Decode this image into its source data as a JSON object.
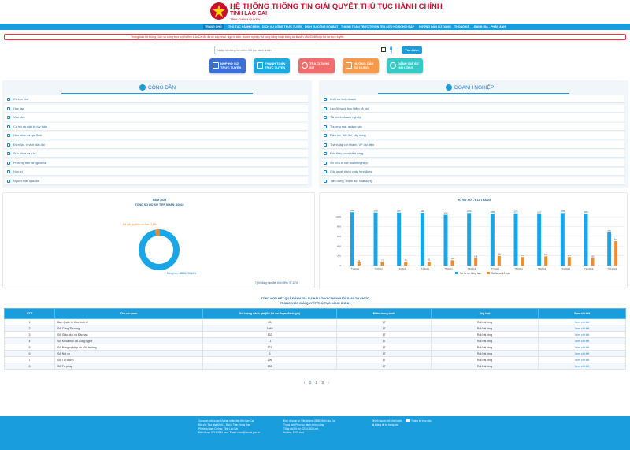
{
  "header": {
    "title_line1": "HỆ THỐNG THÔNG TIN GIẢI QUYẾT THỦ TỤC HÀNH CHÍNH",
    "title_line2": "TỈNH LÀO CAI",
    "subtitle": "TỈNH CHÍNH QUYỀN",
    "brand_color": "#c8102e"
  },
  "nav": {
    "items": [
      {
        "label": "TRANG CHỦ"
      },
      {
        "label": "THỦ TỤC HÀNH CHÍNH"
      },
      {
        "label": "DỊCH VỤ CÔNG TRỰC TUYẾN"
      },
      {
        "label": "DỊCH VỤ CÔNG NỔI BẬT"
      },
      {
        "label": "THANH TOÁN TRỰC TUYẾN"
      },
      {
        "label": "TRA CỨU HỒ SƠ"
      },
      {
        "label": "HỎI ĐÁP"
      },
      {
        "label": "HƯỚNG DẪN SỬ DỤNG"
      },
      {
        "label": "THỐNG KÊ"
      },
      {
        "label": "ĐÁNH GIÁ - PHẢN ÁNH"
      }
    ],
    "color": "#1a9ddc"
  },
  "marquee": {
    "text": "Thông báo hệ thống Dịch vụ công trực tuyến tỉnh Lào Cai đã được cập nhật. Người dân, doanh nghiệp vui lòng đăng nhập bằng tài khoản VNeID để nộp hồ sơ trực tuyến."
  },
  "search": {
    "placeholder": "Nhập nội dung tìm kiếm thủ tục hành chính",
    "button": "Tìm kiếm"
  },
  "quick_actions": [
    {
      "label": "NỘP HỒ SƠ TRỰC TUYẾN",
      "color": "#3a6fd8"
    },
    {
      "label": "THANH TOÁN TRỰC TUYẾN",
      "color": "#1aa9e0"
    },
    {
      "label": "TRA CỨU HỒ SƠ",
      "color": "#f16d6d"
    },
    {
      "label": "HƯỚNG DẪN SỬ DỤNG",
      "color": "#f59a4a"
    },
    {
      "label": "ĐÁNH GIÁ SỰ HÀI LÒNG",
      "color": "#36c9c6"
    }
  ],
  "citizen": {
    "title": "CÔNG DÂN",
    "items": [
      {
        "label": "Có con nhỏ"
      },
      {
        "label": "Học tập"
      },
      {
        "label": "Việc làm"
      },
      {
        "label": "Cư trú và giấy tờ tùy thân"
      },
      {
        "label": "Hôn nhân và gia đình"
      },
      {
        "label": "Điện lực, nhà ở, đất đai"
      },
      {
        "label": "Sức khỏe và y tế"
      },
      {
        "label": "Phương tiện và người lái"
      },
      {
        "label": "Hưu trí"
      },
      {
        "label": "Người thân qua đời"
      }
    ]
  },
  "business": {
    "title": "DOANH NGHIỆP",
    "items": [
      {
        "label": "Khởi sự kinh doanh"
      },
      {
        "label": "Lao động và bảo hiểm xã hội"
      },
      {
        "label": "Tài chính doanh nghiệp"
      },
      {
        "label": "Thương mại, quảng cáo"
      },
      {
        "label": "Điện lực, đất đai, xây dựng"
      },
      {
        "label": "Thành lập chi nhánh, VP đại diện"
      },
      {
        "label": "Đấu thầu, mua sắm công"
      },
      {
        "label": "Sở hữu trí tuệ doanh nghiệp"
      },
      {
        "label": "Giải quyết tranh chấp hợp đồng"
      },
      {
        "label": "Tạm dừng, chấm dứt hoạt động"
      }
    ]
  },
  "charts": {
    "donut": {
      "title_line1": "NĂM 2024",
      "title_line2": "TỔNG SỐ HỒ SƠ TIẾP NHẬN: 10024",
      "label_small": "Đã giải quyết trước hạn: 2,85%",
      "label_large": "Đúng hạn: 88865, 96,64%",
      "note": "Tỷ lệ đúng hạn đến thời điểm: 97,15%"
    },
    "bar": {
      "title": "HỒ SƠ XỬ LÝ 12 THÁNG",
      "legend_a": "Số hồ sơ đúng hạn",
      "legend_b": "Số hồ sơ trễ hạn"
    }
  },
  "chart_data": [
    {
      "type": "pie",
      "categories": [
        "Đúng hạn",
        "Trước hạn"
      ],
      "values": [
        96.64,
        3.36
      ],
      "colors": [
        "#1aa6e6",
        "#f28c28"
      ],
      "title": "NĂM 2024"
    },
    {
      "type": "bar",
      "categories": [
        "T1/2024",
        "T2/2024",
        "T3/2024",
        "T4/2024",
        "T5/2024",
        "T6/2024",
        "T7/2024",
        "T8/2024",
        "T9/2024",
        "T10/2024",
        "T11/2024",
        "T12/2024"
      ],
      "series": [
        {
          "name": "Số hồ sơ đúng hạn",
          "values": [
            1096,
            1089,
            1087,
            1083,
            1042,
            1079,
            1068,
            1071,
            1057,
            1078,
            1064,
            679
          ],
          "color": "#1aa6e6"
        },
        {
          "name": "Số hồ sơ trễ hạn",
          "values": [
            64,
            71,
            76,
            82,
            108,
            148,
            196,
            173,
            190,
            173,
            150,
            502
          ],
          "color": "#f28c28"
        }
      ],
      "ylim": [
        0,
        1100
      ],
      "yticks": [
        0,
        200,
        400,
        600,
        800,
        1000
      ],
      "title": "HỒ SƠ XỬ LÝ 12 THÁNG",
      "legend": "bottom"
    }
  ],
  "table": {
    "title_line1": "TỔNG HỢP KẾT QUẢ ĐÁNH GIÁ SỰ HÀI LÒNG CỦA NGƯỜI DÂN, TỔ CHỨC",
    "title_line2": "TRONG VIỆC GIẢI QUYẾT THỦ TỤC HÀNH CHÍNH",
    "headers": [
      "STT",
      "Tên cơ quan",
      "Số lượng đánh giá (Số hồ sơ được đánh giá)",
      "Điểm trung bình",
      "Xếp loại",
      "Xem chi tiết"
    ],
    "rows": [
      {
        "stt": "1",
        "name": "Ban Quản lý Khu kinh tế",
        "count": "83",
        "score": "17",
        "rank": "Rất hài lòng",
        "detail": "Xem chi tiết"
      },
      {
        "stt": "2",
        "name": "Sở Công Thương",
        "count": "1948",
        "score": "17",
        "rank": "Rất hài lòng",
        "detail": "Xem chi tiết"
      },
      {
        "stt": "3",
        "name": "Sở Giáo dục và Đào tạo",
        "count": "132",
        "score": "17",
        "rank": "Rất hài lòng",
        "detail": "Xem chi tiết"
      },
      {
        "stt": "4",
        "name": "Sở Khoa học và Công nghệ",
        "count": "71",
        "score": "17",
        "rank": "Rất hài lòng",
        "detail": "Xem chi tiết"
      },
      {
        "stt": "5",
        "name": "Sở Nông nghiệp và Môi trường",
        "count": "327",
        "score": "17",
        "rank": "Rất hài lòng",
        "detail": "Xem chi tiết"
      },
      {
        "stt": "6",
        "name": "Sở Nội vụ",
        "count": "3",
        "score": "17",
        "rank": "Rất hài lòng",
        "detail": "Xem chi tiết"
      },
      {
        "stt": "7",
        "name": "Sở Tài chính",
        "count": "296",
        "score": "17",
        "rank": "Rất hài lòng",
        "detail": "Xem chi tiết"
      },
      {
        "stt": "8",
        "name": "Sở Tư pháp",
        "count": "132",
        "score": "17",
        "rank": "Rất hài lòng",
        "detail": "Xem chi tiết"
      }
    ]
  },
  "pager": {
    "prev": "‹",
    "p1": "1",
    "p2": "2",
    "p3": "3",
    "next": "›"
  },
  "footer": {
    "col1": [
      "Cơ quan chủ quản: Ủy ban nhân dân tỉnh Lào Cai",
      "Địa chỉ: Tòa nhà Khối 3, Đại lộ Trần Hưng Đạo",
      "Phường Nam Cường, Tỉnh Lào Cai",
      "Điện thoại: 0214.3840.xxx - Email: ubnd@laocai.gov.vn"
    ],
    "col2": [
      "Đơn vị quản lý: Văn phòng UBND tỉnh Lào Cai",
      "Trung tâm Phục vụ hành chính công",
      "Tổng đài hỗ trợ: 0214.3820.xxx",
      "Hotline: 1900 xxxx"
    ],
    "col3": [
      "Ghi rõ nguồn khi phát hành",
      "lại thông tin từ trang này"
    ],
    "col4": [
      "Thống kê truy cập"
    ]
  }
}
